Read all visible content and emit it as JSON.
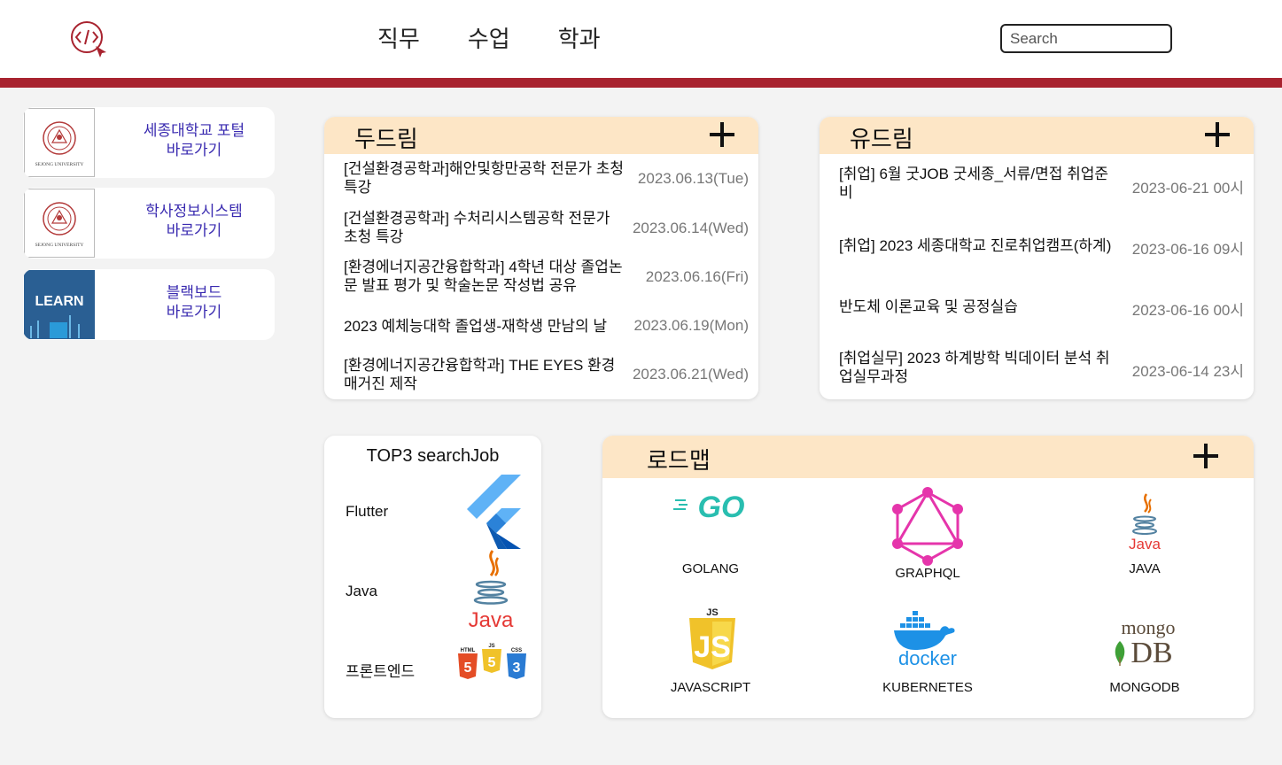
{
  "nav": {
    "items": [
      "직무",
      "수업",
      "학과"
    ]
  },
  "search": {
    "placeholder": "Search"
  },
  "links": [
    {
      "line1": "세종대학교 포털",
      "line2": "바로가기",
      "thumb_text": "SEJONG UNIVERSITY"
    },
    {
      "line1": "학사정보시스템",
      "line2": "바로가기",
      "thumb_text": "SEJONG UNIVERSITY"
    },
    {
      "line1": "블랙보드",
      "line2": "바로가기",
      "thumb_text": "LEARN"
    }
  ],
  "dodream": {
    "title": "두드림",
    "items": [
      {
        "title": "[건설환경공학과]해안및항만공학 전문가 초청 특강",
        "date": "2023.06.13(Tue)"
      },
      {
        "title": "[건설환경공학과] 수처리시스템공학 전문가 초청 특강",
        "date": "2023.06.14(Wed)"
      },
      {
        "title": "[환경에너지공간융합학과] 4학년 대상 졸업논문 발표 평가 및 학술논문 작성법 공유",
        "date": "2023.06.16(Fri)"
      },
      {
        "title": "2023 예체능대학 졸업생-재학생 만남의 날",
        "date": "2023.06.19(Mon)"
      },
      {
        "title": "[환경에너지공간융합학과] THE EYES 환경매거진 제작",
        "date": "2023.06.21(Wed)"
      }
    ]
  },
  "yudream": {
    "title": "유드림",
    "items": [
      {
        "title": "[취업] 6월 굿JOB 굿세종_서류/면접 취업준비",
        "date": "2023-06-21 00시"
      },
      {
        "title": "[취업] 2023 세종대학교 진로취업캠프(하계)",
        "date": "2023-06-16 09시"
      },
      {
        "title": "반도체 이론교육 및 공정실습",
        "date": "2023-06-16 00시"
      },
      {
        "title": "[취업실무] 2023 하계방학 빅데이터 분석 취업실무과정",
        "date": "2023-06-14 23시"
      }
    ]
  },
  "top3": {
    "title": "TOP3 searchJob",
    "items": [
      "Flutter",
      "Java",
      "프론트엔드"
    ],
    "java_logo_text": "Java",
    "fe_badges": [
      "HTML",
      "JS",
      "CSS"
    ]
  },
  "roadmap": {
    "title": "로드맵",
    "items": [
      {
        "label": "GOLANG",
        "logo_text": "GO"
      },
      {
        "label": "GRAPHQL",
        "logo_text": ""
      },
      {
        "label": "JAVA",
        "logo_text": "Java"
      },
      {
        "label": "JAVASCRIPT",
        "logo_text": "JS"
      },
      {
        "label": "KUBERNETES",
        "logo_text": "docker"
      },
      {
        "label": "MONGODB",
        "logo_text": "mongo"
      }
    ],
    "mongo_sub": "DB"
  },
  "colors": {
    "accent_red": "#a8232f",
    "panel_header": "#fde6c6",
    "link_text": "#3a2bb0"
  }
}
